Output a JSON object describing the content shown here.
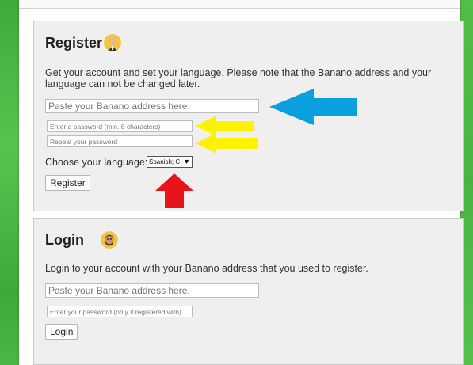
{
  "register": {
    "title": "Register",
    "description": "Get your account and set your language. Please note that the Banano address and your language can not be changed later.",
    "address_placeholder": "Paste your Banano address here.",
    "password_placeholder": "Enter a password (min. 8 characters)",
    "repeat_placeholder": "Repeat your password",
    "language_label": "Choose your language:",
    "language_value": "Spanish; C",
    "button": "Register"
  },
  "login": {
    "title": "Login",
    "description": "Login to your account with your Banano address that you used to register.",
    "address_placeholder": "Paste your Banano address here.",
    "password_placeholder": "Enter your password (only if registered with)",
    "button": "Login"
  },
  "colors": {
    "blue_arrow": "#0aa0e0",
    "yellow_arrow": "#fff200",
    "red_arrow": "#e8141c",
    "background": "#4cb944"
  }
}
